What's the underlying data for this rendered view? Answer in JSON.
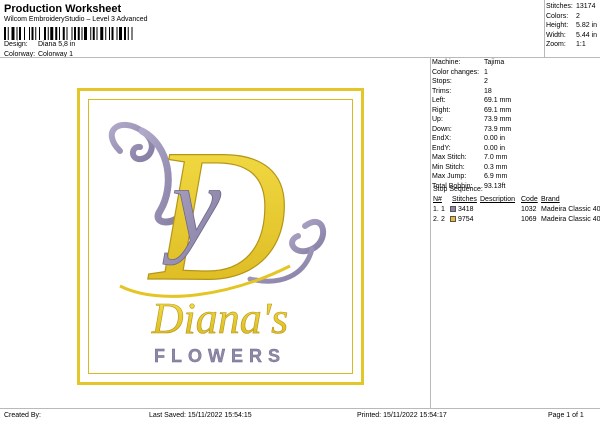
{
  "header": {
    "title": "Production Worksheet",
    "subtitle": "Wilcom EmbroideryStudio – Level 3 Advanced"
  },
  "design_info": {
    "design_label": "Design:",
    "design_value": "Diana 5,8 in",
    "colorway_label": "Colorway:",
    "colorway_value": "Colorway 1"
  },
  "summary": {
    "stitches_label": "Stitches:",
    "stitches_value": "13174",
    "colors_label": "Colors:",
    "colors_value": "2",
    "height_label": "Height:",
    "height_value": "5.82 in",
    "width_label": "Width:",
    "width_value": "5.44 in",
    "zoom_label": "Zoom:",
    "zoom_value": "1:1"
  },
  "machine_details": [
    {
      "label": "Machine:",
      "value": "Tajima"
    },
    {
      "label": "Color changes:",
      "value": "1"
    },
    {
      "label": "Stops:",
      "value": "2"
    },
    {
      "label": "Trims:",
      "value": "18"
    },
    {
      "label": "Left:",
      "value": "69.1 mm"
    },
    {
      "label": "Right:",
      "value": "69.1 mm"
    },
    {
      "label": "Up:",
      "value": "73.9 mm"
    },
    {
      "label": "Down:",
      "value": "73.9 mm"
    },
    {
      "label": "EndX:",
      "value": "0.00 in"
    },
    {
      "label": "EndY:",
      "value": "0.00 in"
    },
    {
      "label": "Max Stitch:",
      "value": "7.0 mm"
    },
    {
      "label": "Min Stitch:",
      "value": "0.3 mm"
    },
    {
      "label": "Max Jump:",
      "value": "6.9 mm"
    },
    {
      "label": "Total Bobbin:",
      "value": "93.13ft"
    }
  ],
  "stop_sequence": {
    "title": "Stop Sequence:",
    "columns": {
      "n": "N#",
      "stitches": "Stitches",
      "description": "Description",
      "code": "Code",
      "brand": "Brand"
    },
    "rows": [
      {
        "index": "1.",
        "n": "1",
        "color": "#8d86a8",
        "code_thread": "3418",
        "stitches": "1032",
        "brand": "Madeira Classic 40"
      },
      {
        "index": "2.",
        "n": "2",
        "color": "#f0b42d",
        "code_thread": "9754",
        "stitches": "1069",
        "brand": "Madeira Classic 40"
      }
    ]
  },
  "design_art": {
    "monogram_letter_d": "D",
    "monogram_letter_y": "y",
    "name": "Diana's",
    "tagline": "FLOWERS",
    "gold": "#eed12a",
    "gold_dark": "#b49516",
    "lavender": "#9f97b7",
    "lavender_dark": "#6e6787",
    "frame": "#e3c72a"
  },
  "footer": {
    "created_by": "Created By:",
    "last_saved": "Last Saved: 15/11/2022 15:54:15",
    "printed": "Printed: 15/11/2022 15:54:17",
    "page": "Page 1 of 1"
  }
}
